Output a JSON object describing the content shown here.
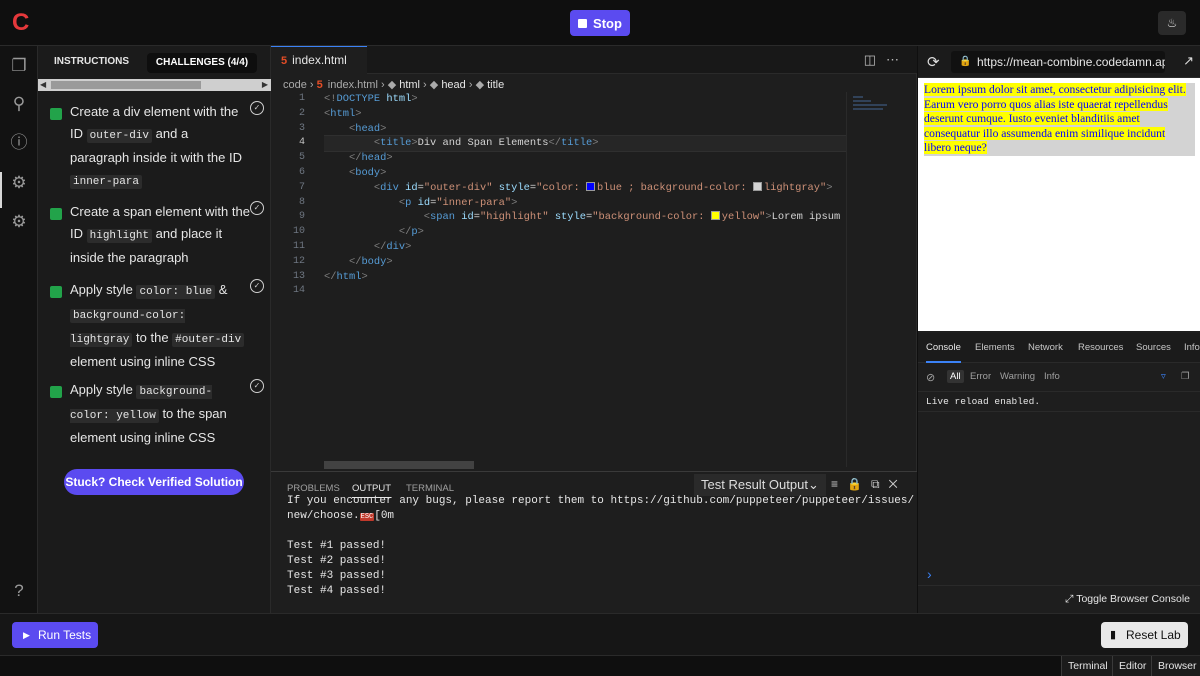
{
  "header": {
    "stop_label": "Stop",
    "logo": "C"
  },
  "sidebar_icons": [
    "files-icon",
    "search-icon",
    "info-icon",
    "bot-icon",
    "settings-icon",
    "help-icon"
  ],
  "instructions": {
    "tab_instructions": "INSTRUCTIONS",
    "tab_challenges": "CHALLENGES (4/4)",
    "tasks": [
      {
        "pre": "Create a div element with the ID ",
        "code1": "outer-div",
        "mid": " and a paragraph inside it with the ID ",
        "code2": "inner-para",
        "post": ""
      },
      {
        "pre": "Create a span element with the ID ",
        "code1": "highlight",
        "mid": " and place it inside the paragraph",
        "code2": "",
        "post": ""
      },
      {
        "pre": "Apply style ",
        "code1": "color: blue",
        "mid": " & ",
        "code2": "background-color: lightgray",
        "post": " to the ",
        "code3": "#outer-div",
        "post2": " element using inline CSS"
      },
      {
        "pre": "Apply style ",
        "code1": "background-color: yellow",
        "mid": " to the span element using inline CSS",
        "code2": "",
        "post": ""
      }
    ],
    "stuck_label": "Stuck? Check Verified Solution"
  },
  "editor": {
    "tab_label": "index.html",
    "breadcrumb": [
      "code",
      "index.html",
      "html",
      "head",
      "title"
    ],
    "line_numbers": [
      "1",
      "2",
      "3",
      "4",
      "5",
      "6",
      "7",
      "8",
      "9",
      "10",
      "11",
      "12",
      "13",
      "14"
    ],
    "current_line": 4
  },
  "panel": {
    "tabs": [
      "PROBLEMS",
      "OUTPUT",
      "TERMINAL"
    ],
    "active_tab": "OUTPUT",
    "select_value": "Test Result Output",
    "output_lines": [
      "If you encounter any bugs, please report them to https://github.com/puppeteer/puppeteer/issues/",
      "new/choose.",
      "[0m",
      "Test #1 passed!",
      "Test #2 passed!",
      "Test #3 passed!",
      "Test #4 passed!"
    ]
  },
  "browser": {
    "url": "https://mean-combine.codedamn.ap",
    "preview_text": "Lorem ipsum dolor sit amet, consectetur adipisicing elit. Earum vero porro quos alias iste quaerat repellendus deserunt cumque. Iusto eveniet blanditiis amet consequatur illo assumenda enim similique incidunt libero neque?",
    "devtools_tabs": [
      "Console",
      "Elements",
      "Network",
      "Resources",
      "Sources",
      "Info"
    ],
    "filters": [
      "All",
      "Error",
      "Warning",
      "Info"
    ],
    "console_log": "Live reload enabled.",
    "toggle_label": "Toggle Browser Console"
  },
  "bottom": {
    "run_label": "Run Tests",
    "reset_label": "Reset Lab"
  },
  "status": {
    "terminal": "Terminal",
    "editor": "Editor",
    "browser": "Browser"
  },
  "colors": {
    "accent": "#5b4bf0",
    "success": "#22a34a",
    "logo": "#e5383b"
  }
}
